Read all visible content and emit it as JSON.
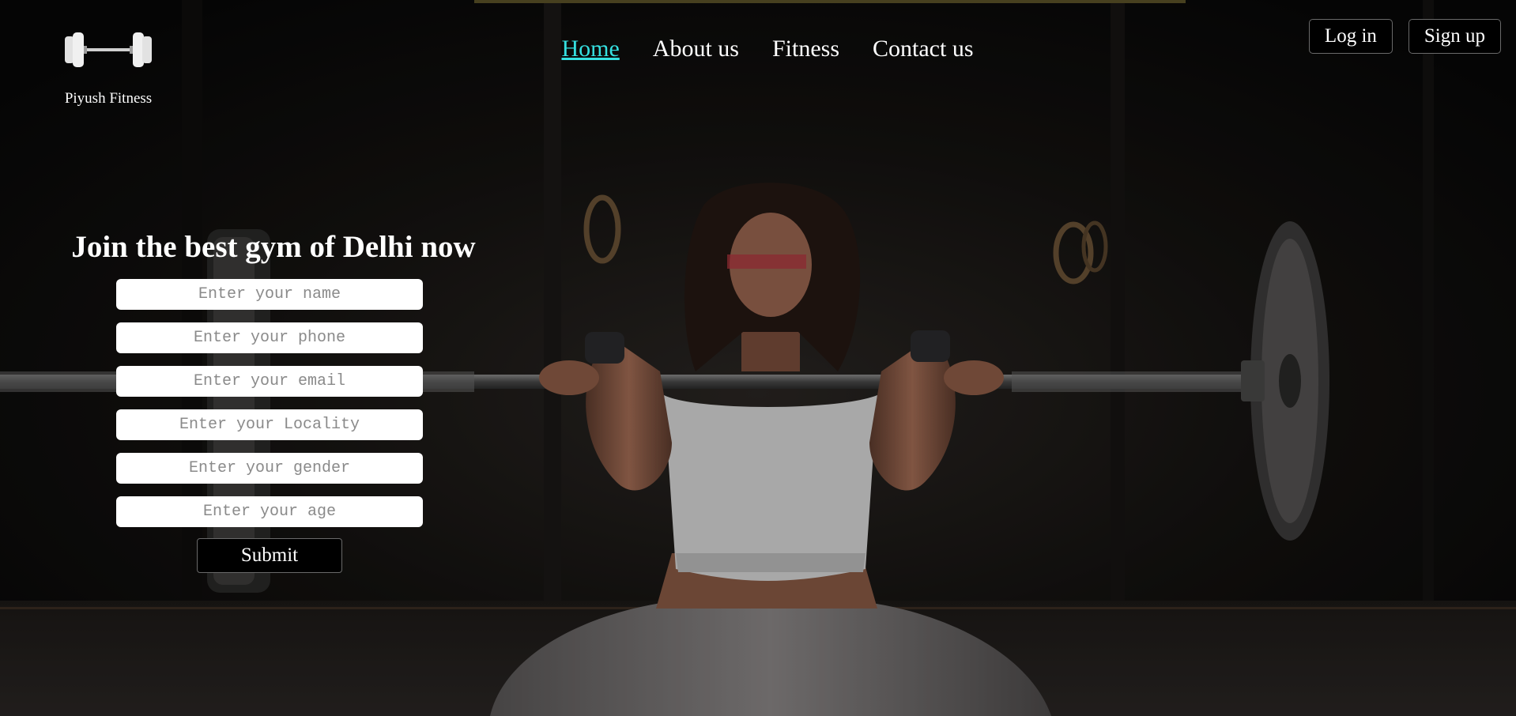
{
  "brand": {
    "name": "Piyush Fitness",
    "logo_icon": "barbell-icon"
  },
  "nav": {
    "items": [
      {
        "label": "Home",
        "active": true
      },
      {
        "label": "About us",
        "active": false
      },
      {
        "label": "Fitness",
        "active": false
      },
      {
        "label": "Contact us",
        "active": false
      }
    ]
  },
  "auth": {
    "login_label": "Log in",
    "signup_label": "Sign up"
  },
  "join": {
    "title": "Join the best gym of Delhi now",
    "fields": {
      "name": {
        "placeholder": "Enter your name",
        "value": ""
      },
      "phone": {
        "placeholder": "Enter your phone",
        "value": ""
      },
      "email": {
        "placeholder": "Enter your email",
        "value": ""
      },
      "locality": {
        "placeholder": "Enter your Locality",
        "value": ""
      },
      "gender": {
        "placeholder": "Enter your gender",
        "value": ""
      },
      "age": {
        "placeholder": "Enter your age",
        "value": ""
      }
    },
    "submit_label": "Submit"
  },
  "colors": {
    "active_nav": "#35e0e0",
    "button_bg": "#000000",
    "text": "#ffffff",
    "background": "#0b0b0b"
  }
}
